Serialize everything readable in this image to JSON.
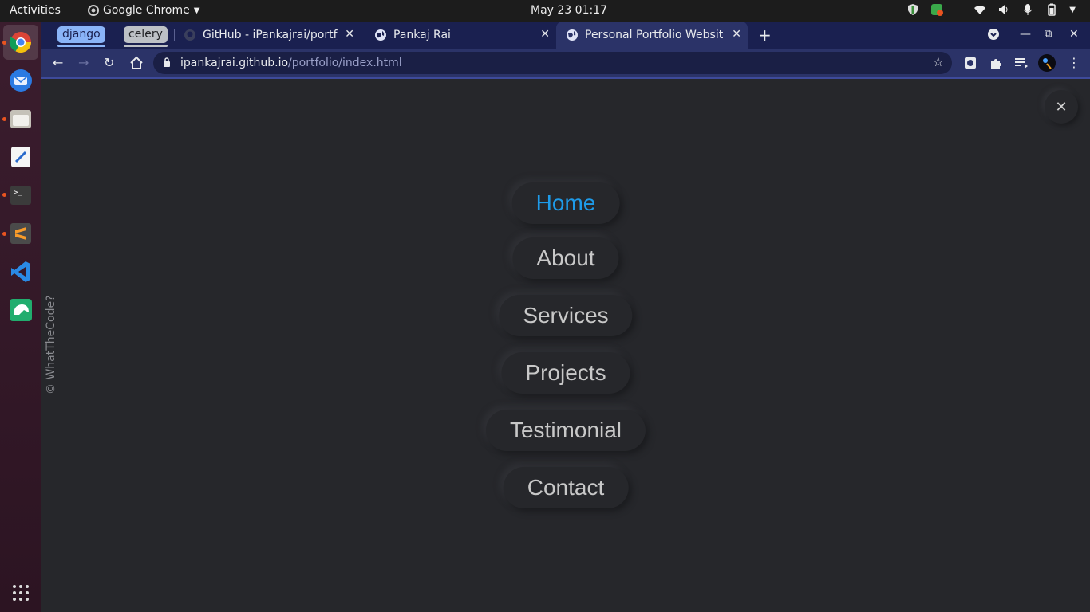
{
  "system": {
    "activities": "Activities",
    "app_name": "Google Chrome",
    "clock": "May 23  01:17"
  },
  "browser": {
    "tab_groups": [
      {
        "label": "django",
        "color": "#8ab4f8"
      },
      {
        "label": "celery",
        "color": "#bdc1c6"
      }
    ],
    "tabs": [
      {
        "title": "GitHub - iPankajrai/portfo",
        "icon": "github-icon"
      },
      {
        "title": "Pankaj Rai",
        "icon": "globe-icon"
      },
      {
        "title": "Personal Portfolio Websit",
        "icon": "globe-icon",
        "active": true
      }
    ],
    "url_host": "ipankajrai.github.io",
    "url_path": "/portfolio/index.html"
  },
  "page": {
    "credit": "© WhatTheCode?",
    "nav_items": [
      "Home",
      "About",
      "Services",
      "Projects",
      "Testimonial",
      "Contact"
    ],
    "active_nav": "Home",
    "accent_color": "#1e9be9"
  }
}
